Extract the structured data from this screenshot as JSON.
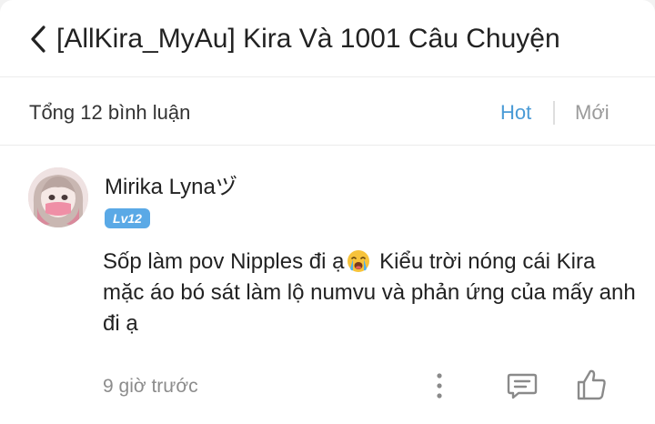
{
  "header": {
    "title": "[AllKira_MyAu] Kira Và 1001 Câu Chuyện",
    "back_icon": "chevron-left-icon"
  },
  "comments_bar": {
    "total_label": "Tổng 12 bình luận",
    "sort_hot": "Hot",
    "sort_new": "Mới",
    "active_color": "#4a9bd6",
    "inactive_color": "#9a9a9a"
  },
  "comment": {
    "username": "Mirika Lynaヅ",
    "level": "Lv12",
    "text_before_emoji": "Sốp làm pov Nipples đi ạ",
    "emoji": "loudly-crying-face-icon",
    "text_after_emoji": " Kiểu trời nóng cái Kira mặc áo bó sát làm lộ numvu và phản ứng của mấy anh đi ạ",
    "time": "9 giờ trước",
    "actions": [
      "more-icon",
      "reply-icon",
      "like-icon"
    ],
    "badge_color": "#5aa9e6"
  }
}
